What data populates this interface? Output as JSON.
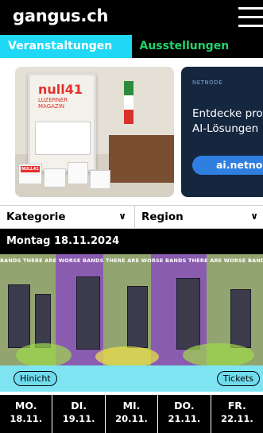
{
  "header": {
    "logo": "gangus.ch",
    "menu_icon": "hamburger-menu-icon"
  },
  "tabs": [
    {
      "label": "Veranstaltungen",
      "active": true
    },
    {
      "label": "Ausstellungen",
      "active": false
    }
  ],
  "ads": {
    "poster": {
      "title": "null41",
      "subtitle": "LUZERNER MAGAZIN",
      "box_label": "NULL41"
    },
    "netnode": {
      "brand": "NETNODE",
      "headline_line1": "Entdecke pro",
      "headline_line2": "AI-Lösungen",
      "cta": "ai.netno"
    }
  },
  "filters": {
    "category": "Kategorie",
    "region": "Region",
    "chevron_icon": "chevron-down-icon"
  },
  "date_heading": "Montag 18.11.2024",
  "event": {
    "poster_text": "BANDS THERE ARE WORSE BANDS THERE ARE WORSE BANDS THERE ARE WORSE BANDS THERE",
    "hinicht_label": "Hinicht",
    "tickets_label": "Tickets"
  },
  "days": [
    {
      "name": "MO.",
      "date": "18.11."
    },
    {
      "name": "DI.",
      "date": "19.11."
    },
    {
      "name": "MI.",
      "date": "20.11."
    },
    {
      "name": "DO.",
      "date": "21.11."
    },
    {
      "name": "FR.",
      "date": "22.11."
    }
  ],
  "colors": {
    "accent_cyan": "#1ed8f5",
    "accent_green": "#1fd46c",
    "ad_navy": "#15263f",
    "cta_blue": "#2f7fe0"
  }
}
